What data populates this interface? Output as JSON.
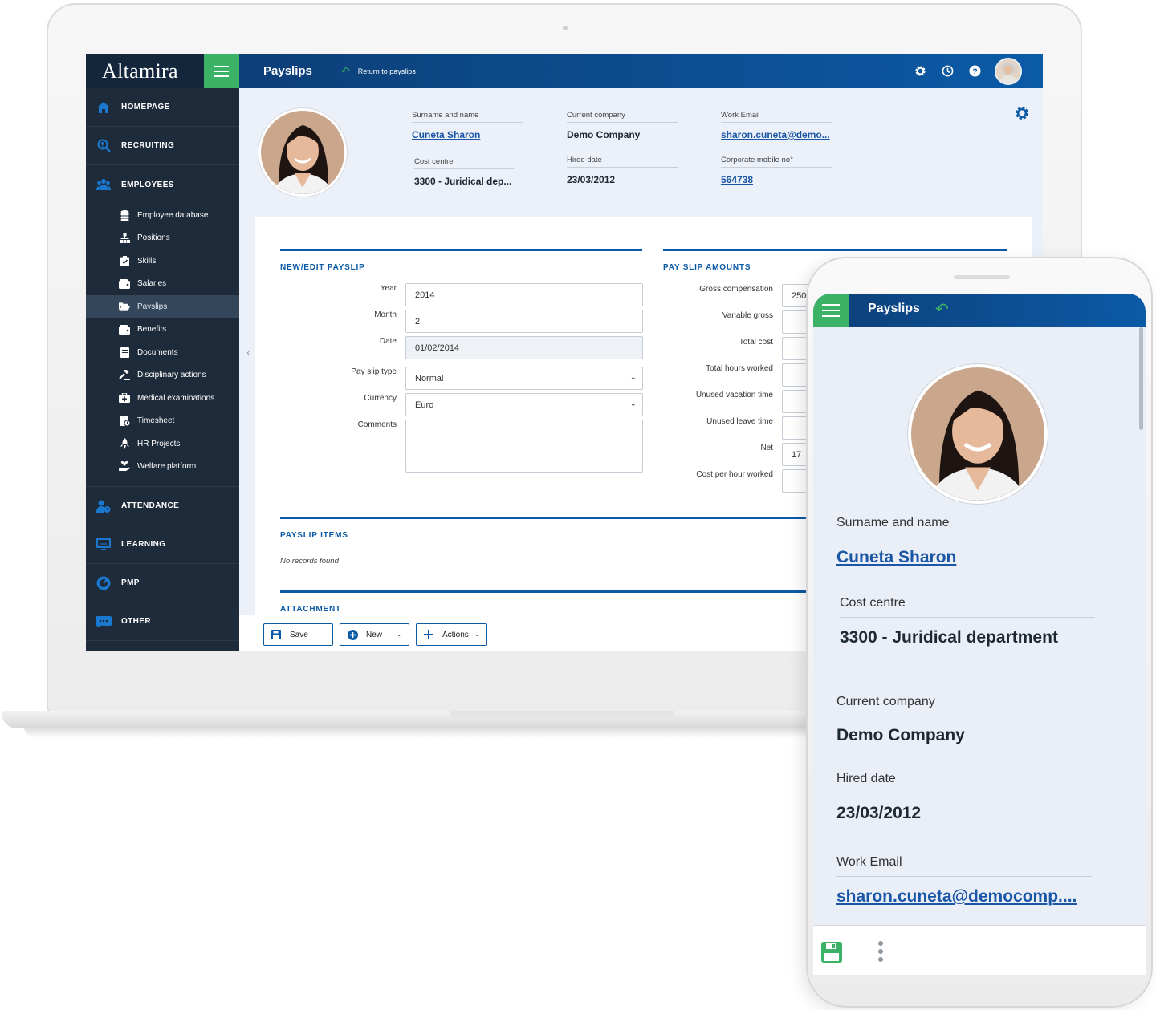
{
  "laptop": {
    "brand": "Altamira",
    "page_title": "Payslips",
    "return_link": "Return to payslips",
    "sidebar": {
      "main_items": [
        {
          "label": "HOMEPAGE"
        },
        {
          "label": "RECRUITING"
        },
        {
          "label": "EMPLOYEES"
        },
        {
          "label": "ATTENDANCE"
        },
        {
          "label": "LEARNING"
        },
        {
          "label": "PMP"
        },
        {
          "label": "OTHER"
        }
      ],
      "employee_items": [
        {
          "label": "Employee database"
        },
        {
          "label": "Positions"
        },
        {
          "label": "Skills"
        },
        {
          "label": "Salaries"
        },
        {
          "label": "Payslips"
        },
        {
          "label": "Benefits"
        },
        {
          "label": "Documents"
        },
        {
          "label": "Disciplinary actions"
        },
        {
          "label": "Medical examinations"
        },
        {
          "label": "Timesheet"
        },
        {
          "label": "HR Projects"
        },
        {
          "label": "Welfare platform"
        }
      ],
      "active_item": "Payslips"
    },
    "profile": {
      "surname_label": "Surname and name",
      "surname_value": "Cuneta Sharon",
      "company_label": "Current company",
      "company_value": "Demo Company",
      "email_label": "Work Email",
      "email_value": "sharon.cuneta@demo...",
      "cost_label": "Cost centre",
      "cost_value": "3300 - Juridical dep...",
      "hired_label": "Hired date",
      "hired_value": "23/03/2012",
      "mobile_label": "Corporate mobile no°",
      "mobile_value": "564738"
    },
    "edit_section": {
      "title": "NEW/EDIT PAYSLIP",
      "fields": [
        {
          "label": "Year",
          "value": "2014"
        },
        {
          "label": "Month",
          "value": "2"
        },
        {
          "label": "Date",
          "value": "01/02/2014"
        },
        {
          "label": "Pay slip type",
          "value": "Normal"
        },
        {
          "label": "Currency",
          "value": "Euro"
        },
        {
          "label": "Comments",
          "value": ""
        }
      ]
    },
    "amounts_section": {
      "title": "PAY SLIP AMOUNTS",
      "fields": [
        {
          "label": "Gross compensation",
          "value": "250"
        },
        {
          "label": "Variable gross",
          "value": ""
        },
        {
          "label": "Total cost",
          "value": ""
        },
        {
          "label": "Total hours worked",
          "value": ""
        },
        {
          "label": "Unused vacation time",
          "value": ""
        },
        {
          "label": "Unused leave time",
          "value": ""
        },
        {
          "label": "Net",
          "value": "17"
        },
        {
          "label": "Cost per hour worked",
          "value": ""
        }
      ]
    },
    "items_section": {
      "title": "PAYSLIP ITEMS",
      "empty": "No records found"
    },
    "attachment_section": {
      "title": "ATTACHMENT"
    },
    "buttons": {
      "save": "Save",
      "new": "New",
      "actions": "Actions"
    },
    "colors": {
      "primary": "#0b5aa6",
      "accent": "#3bb266",
      "sidebar": "#1d2b3a"
    }
  },
  "phone": {
    "title": "Payslips",
    "fields": [
      {
        "label": "Surname and name",
        "value": "Cuneta Sharon"
      },
      {
        "label": "Cost centre",
        "value": "3300 - Juridical department"
      },
      {
        "label": "Current company",
        "value": "Demo Company"
      },
      {
        "label": "Hired date",
        "value": "23/03/2012"
      },
      {
        "label": "Work Email",
        "value": "sharon.cuneta@democomp...."
      }
    ]
  }
}
